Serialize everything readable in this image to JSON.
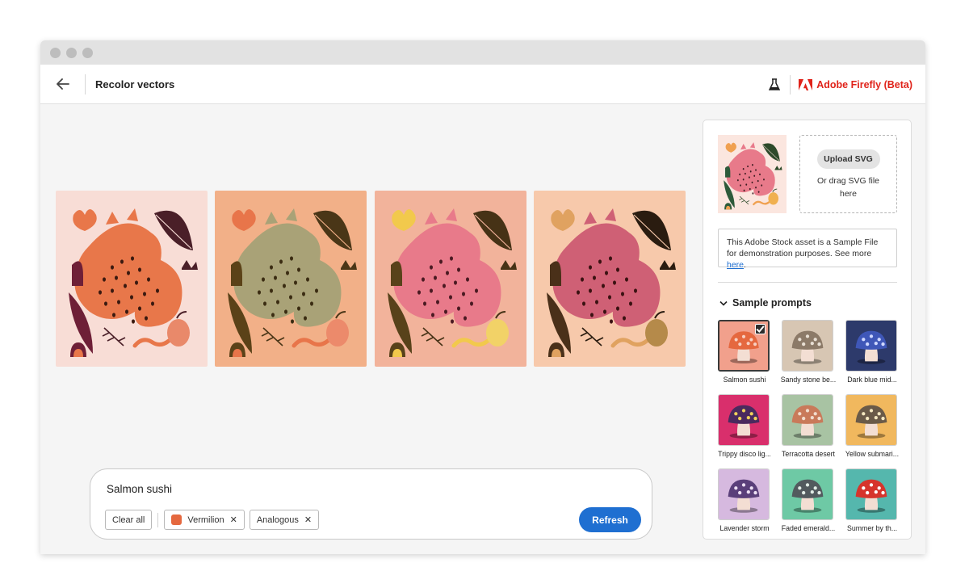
{
  "window": {
    "controls": [
      "close",
      "minimize",
      "maximize"
    ]
  },
  "appbar": {
    "back_icon": "arrow-left-icon",
    "title": "Recolor vectors",
    "lab_icon": "flask-icon",
    "brand": "Adobe Firefly (Beta)"
  },
  "variations": [
    {
      "bg": "#f8ddd6",
      "cat": "#e8774a",
      "leaf_dark": "#4a1f28",
      "leaf_long": "#6e1f37",
      "accent": "#e8774a",
      "pear": "#e9896a",
      "spots": "#3a1a10"
    },
    {
      "bg": "#f2b088",
      "cat": "#a9a277",
      "leaf_dark": "#4a3617",
      "leaf_long": "#5b4218",
      "accent": "#e8754a",
      "pear": "#ec8a6b",
      "spots": "#3b2c12"
    },
    {
      "bg": "#f2b39b",
      "cat": "#e87a8a",
      "leaf_dark": "#463216",
      "leaf_long": "#58421a",
      "accent": "#f2c94c",
      "pear": "#f2d267",
      "spots": "#4a1a22"
    },
    {
      "bg": "#f7c9ab",
      "cat": "#cf6075",
      "leaf_dark": "#2a1c10",
      "leaf_long": "#4a3019",
      "accent": "#e0a260",
      "pear": "#b58a4a",
      "spots": "#3a1212"
    }
  ],
  "prompt": {
    "text": "Salmon sushi",
    "chips": [
      {
        "label": "Clear all"
      },
      {
        "label": "Vermilion",
        "swatch": "#e5683f"
      },
      {
        "label": "Analogous"
      }
    ],
    "refresh_label": "Refresh"
  },
  "panel": {
    "upload_label": "Upload SVG",
    "drag_text": "Or drag SVG file here",
    "notice_text": "This Adobe Stock asset is a Sample File for demonstration purposes. See more ",
    "notice_link": "here",
    "notice_end": ".",
    "sample_prompts_label": "Sample prompts",
    "samples": [
      {
        "label": "Salmon sushi",
        "bg": "#f1a08c",
        "cap": "#e5683f",
        "dots": "#f7d0c3",
        "selected": true
      },
      {
        "label": "Sandy stone be...",
        "bg": "#d7c6b3",
        "cap": "#8c7a68",
        "dots": "#e8dfd3",
        "selected": false
      },
      {
        "label": "Dark blue mid...",
        "bg": "#2d3a6b",
        "cap": "#3f57b8",
        "dots": "#cfd8ff",
        "selected": false
      },
      {
        "label": "Trippy disco lig...",
        "bg": "#d92f6c",
        "cap": "#4a2a5e",
        "dots": "#f2d15a",
        "selected": false
      },
      {
        "label": "Terracotta desert",
        "bg": "#a8c3a3",
        "cap": "#c97a5a",
        "dots": "#f1dccd",
        "selected": false
      },
      {
        "label": "Yellow submari...",
        "bg": "#f1b85e",
        "cap": "#6a5a48",
        "dots": "#f4e7c0",
        "selected": false
      },
      {
        "label": "Lavender storm",
        "bg": "#d6b9df",
        "cap": "#5a3f7a",
        "dots": "#ede0f4",
        "selected": false
      },
      {
        "label": "Faded emerald...",
        "bg": "#6ec9a5",
        "cap": "#525a5e",
        "dots": "#e1ece6",
        "selected": false
      },
      {
        "label": "Summer by th...",
        "bg": "#55b7ad",
        "cap": "#d6342c",
        "dots": "#ffffff",
        "selected": false
      }
    ]
  }
}
